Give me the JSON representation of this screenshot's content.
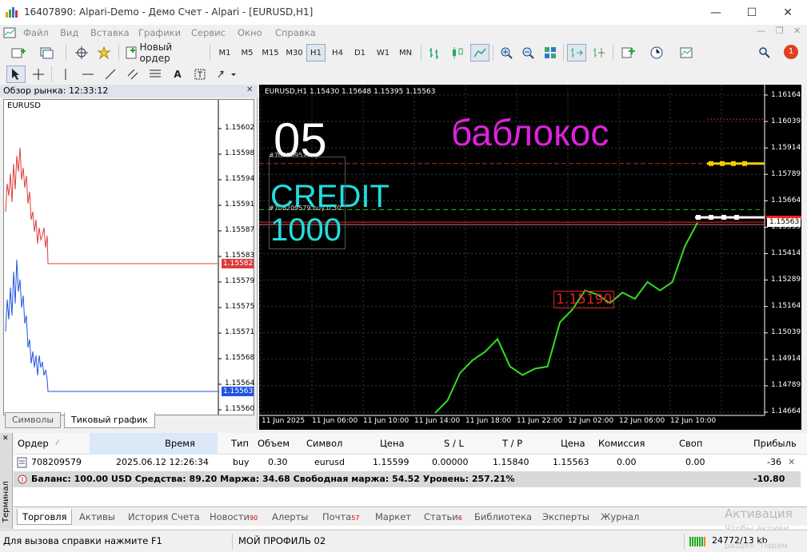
{
  "window": {
    "title": "16407890: Alpari-Demo - Демо Счет - Alpari - [EURUSD,H1]"
  },
  "menu": [
    "Файл",
    "Вид",
    "Вставка",
    "Графики",
    "Сервис",
    "Окно",
    "Справка"
  ],
  "toolbar": {
    "new_order": "Новый ордер",
    "timeframes": [
      "M1",
      "M5",
      "M15",
      "M30",
      "H1",
      "H4",
      "D1",
      "W1",
      "MN"
    ],
    "active_timeframe": "H1",
    "notification_count": "1"
  },
  "market_watch": {
    "title": "Обзор рынка: 12:33:12",
    "symbol": "EURUSD",
    "price_labels": [
      "1.15602",
      "1.15598",
      "1.15594",
      "1.15591",
      "1.15587",
      "1.15583",
      "1.15579",
      "1.15575",
      "1.15571",
      "1.15568",
      "1.15564",
      "1.15560"
    ],
    "ask_tag": "1.15582",
    "bid_tag": "1.15563",
    "tabs": [
      "Символы",
      "Тиковый график"
    ],
    "active_tab": "Тиковый график"
  },
  "chart": {
    "header": "EURUSD,H1  1.15430 1.15648 1.15395 1.15563",
    "big_number": "05",
    "credit_label": "CREDIT",
    "credit_value": "1000",
    "title_text": "баблокос",
    "tp_label": "#708209579 tp",
    "buy_label": "#708209579 buy 0.30",
    "highlight_price": "1.15190",
    "bid_tag": "1.15563",
    "price_labels": [
      "1.16164",
      "1.16039",
      "1.15914",
      "1.15789",
      "1.15664",
      "1.15539",
      "1.15414",
      "1.15289",
      "1.15164",
      "1.15039",
      "1.14914",
      "1.14789",
      "1.14664"
    ],
    "time_labels": [
      "11 Jun 2025",
      "11 Jun 06:00",
      "11 Jun 10:00",
      "11 Jun 14:00",
      "11 Jun 18:00",
      "11 Jun 22:00",
      "12 Jun 02:00",
      "12 Jun 06:00",
      "12 Jun 10:00"
    ],
    "colors": {
      "bg": "#000000",
      "grid": "#3a3a3a",
      "line": "#33dd22",
      "tp": "#cc2222",
      "price": "#ff2222",
      "text_cyan": "#22dddd",
      "text_magenta": "#dd22dd"
    }
  },
  "chart_data": {
    "type": "line",
    "symbol": "EURUSD",
    "timeframe": "H1",
    "x": [
      "11 Jun 14:00",
      "11 Jun 15:00",
      "11 Jun 16:00",
      "11 Jun 17:00",
      "11 Jun 18:00",
      "11 Jun 19:00",
      "11 Jun 20:00",
      "11 Jun 21:00",
      "11 Jun 22:00",
      "11 Jun 23:00",
      "12 Jun 00:00",
      "12 Jun 01:00",
      "12 Jun 02:00",
      "12 Jun 03:00",
      "12 Jun 04:00",
      "12 Jun 05:00",
      "12 Jun 06:00",
      "12 Jun 07:00",
      "12 Jun 08:00",
      "12 Jun 09:00",
      "12 Jun 10:00",
      "12 Jun 11:00"
    ],
    "values": [
      1.1466,
      1.1472,
      1.1485,
      1.1491,
      1.1495,
      1.1501,
      1.1488,
      1.1484,
      1.1487,
      1.1488,
      1.1509,
      1.1515,
      1.1524,
      1.1522,
      1.1518,
      1.1523,
      1.152,
      1.1528,
      1.1524,
      1.1528,
      1.1545,
      1.1556
    ],
    "ylim": [
      1.14664,
      1.16164
    ],
    "tp_level": 1.1584,
    "open_price": 1.15599,
    "current_price": 1.15563
  },
  "terminal": {
    "side_label": "Терминал",
    "headers": {
      "order": "Ордер",
      "time": "Время",
      "type": "Тип",
      "volume": "Объем",
      "symbol": "Символ",
      "price": "Цена",
      "sl": "S / L",
      "tp": "T / P",
      "price2": "Цена",
      "commission": "Комиссия",
      "swap": "Своп",
      "profit": "Прибыль"
    },
    "row": {
      "order": "708209579",
      "time": "2025.06.12 12:26:34",
      "type": "buy",
      "volume": "0.30",
      "symbol": "eurusd",
      "price": "1.15599",
      "sl": "0.00000",
      "tp": "1.15840",
      "price2": "1.15563",
      "commission": "0.00",
      "swap": "0.00",
      "profit": "-36"
    },
    "balance": "Баланс: 100.00 USD  Средства: 89.20  Маржа: 34.68  Свободная маржа: 54.52  Уровень: 257.21%",
    "balance_profit": "-10.80",
    "tabs": [
      {
        "label": "Торговля"
      },
      {
        "label": "Активы"
      },
      {
        "label": "История Счета"
      },
      {
        "label": "Новости",
        "badge": "90"
      },
      {
        "label": "Алерты"
      },
      {
        "label": "Почта",
        "badge": "57"
      },
      {
        "label": "Маркет"
      },
      {
        "label": "Статьи",
        "badge": "6"
      },
      {
        "label": "Библиотека"
      },
      {
        "label": "Эксперты"
      },
      {
        "label": "Журнал"
      }
    ],
    "active_tab": "Торговля"
  },
  "status": {
    "help": "Для вызова справки нажмите F1",
    "profile": "МОЙ ПРОФИЛЬ 02",
    "traffic": "24772/13 kb",
    "watermark": "Активация",
    "watermark2": "Чтобы активи",
    "watermark3": "раздел \"Парам"
  }
}
